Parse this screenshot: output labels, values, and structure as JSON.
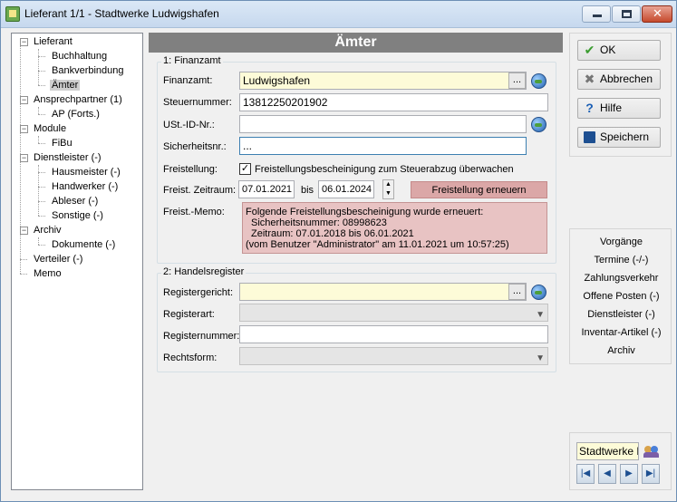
{
  "window": {
    "title": "Lieferant 1/1 - Stadtwerke Ludwigshafen",
    "min_glyph": "",
    "max_glyph": "",
    "close_glyph": "✕"
  },
  "tree": {
    "items": [
      {
        "label": "Lieferant"
      },
      {
        "label": "Buchhaltung"
      },
      {
        "label": "Bankverbindung"
      },
      {
        "label": "Ämter"
      },
      {
        "label": "Ansprechpartner (1)"
      },
      {
        "label": "AP (Forts.)"
      },
      {
        "label": "Module"
      },
      {
        "label": "FiBu"
      },
      {
        "label": "Dienstleister (-)"
      },
      {
        "label": "Hausmeister (-)"
      },
      {
        "label": "Handwerker (-)"
      },
      {
        "label": "Ableser (-)"
      },
      {
        "label": "Sonstige (-)"
      },
      {
        "label": "Archiv"
      },
      {
        "label": "Dokumente (-)"
      },
      {
        "label": "Verteiler (-)"
      },
      {
        "label": "Memo"
      }
    ]
  },
  "main": {
    "header": "Ämter",
    "finanzamt_group": {
      "title": "1: Finanzamt",
      "finanzamt_label": "Finanzamt:",
      "finanzamt_value": "Ludwigshafen",
      "steuernummer_label": "Steuernummer:",
      "steuernummer_value": "13812250201902",
      "ustid_label": "USt.-ID-Nr.:",
      "ustid_value": "",
      "sicherheitsnr_label": "Sicherheitsnr.:",
      "sicherheitsnr_value": "...",
      "freistellung_label": "Freistellung:",
      "freistellung_check_label": "Freistellungsbescheinigung zum Steuerabzug überwachen",
      "freistellung_checked": "✓",
      "zeitraum_label": "Freist. Zeitraum:",
      "zeitraum_from": "07.01.2021",
      "zeitraum_bis": "bis",
      "zeitraum_to": "06.01.2024",
      "erneuern_button": "Freistellung erneuern",
      "memo_label": "Freist.-Memo:",
      "memo_lines": [
        "Folgende Freistellungsbescheinigung wurde erneuert:",
        "  Sicherheitsnummer: 08998623",
        "  Zeitraum: 07.01.2018 bis 06.01.2021",
        "(vom Benutzer \"Administrator\" am 11.01.2021 um 10:57:25)"
      ],
      "ellipsis": "..."
    },
    "handelsregister_group": {
      "title": "2: Handelsregister",
      "registergericht_label": "Registergericht:",
      "registergericht_value": "",
      "registerart_label": "Registerart:",
      "registerart_value": "",
      "registernummer_label": "Registernummer:",
      "registernummer_value": "",
      "rechtsform_label": "Rechtsform:",
      "rechtsform_value": "",
      "ellipsis": "..."
    }
  },
  "actions": {
    "ok": "OK",
    "abbrechen": "Abbrechen",
    "hilfe": "Hilfe",
    "speichern": "Speichern"
  },
  "links": [
    "Vorgänge",
    "Termine (-/-)",
    "Zahlungsverkehr",
    "Offene Posten (-)",
    "Dienstleister (-)",
    "Inventar-Artikel (-)",
    "Archiv"
  ],
  "navigator": {
    "record_value": "Stadtwerke L",
    "first": "|◀",
    "prev": "◀",
    "next": "▶",
    "last": "▶|"
  },
  "colors": {
    "header_bg": "#808080",
    "yellow_field": "#fdfbd8",
    "memo_bg": "#e8c3c3",
    "renew_button": "#dba7a7"
  }
}
